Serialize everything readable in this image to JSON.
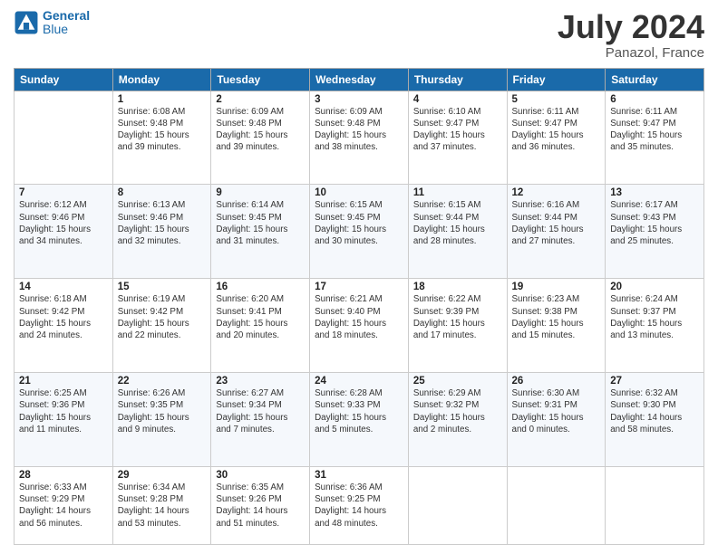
{
  "header": {
    "logo_line1": "General",
    "logo_line2": "Blue",
    "month_year": "July 2024",
    "location": "Panazol, France"
  },
  "weekdays": [
    "Sunday",
    "Monday",
    "Tuesday",
    "Wednesday",
    "Thursday",
    "Friday",
    "Saturday"
  ],
  "weeks": [
    [
      {
        "day": "",
        "info": ""
      },
      {
        "day": "1",
        "info": "Sunrise: 6:08 AM\nSunset: 9:48 PM\nDaylight: 15 hours\nand 39 minutes."
      },
      {
        "day": "2",
        "info": "Sunrise: 6:09 AM\nSunset: 9:48 PM\nDaylight: 15 hours\nand 39 minutes."
      },
      {
        "day": "3",
        "info": "Sunrise: 6:09 AM\nSunset: 9:48 PM\nDaylight: 15 hours\nand 38 minutes."
      },
      {
        "day": "4",
        "info": "Sunrise: 6:10 AM\nSunset: 9:47 PM\nDaylight: 15 hours\nand 37 minutes."
      },
      {
        "day": "5",
        "info": "Sunrise: 6:11 AM\nSunset: 9:47 PM\nDaylight: 15 hours\nand 36 minutes."
      },
      {
        "day": "6",
        "info": "Sunrise: 6:11 AM\nSunset: 9:47 PM\nDaylight: 15 hours\nand 35 minutes."
      }
    ],
    [
      {
        "day": "7",
        "info": "Sunrise: 6:12 AM\nSunset: 9:46 PM\nDaylight: 15 hours\nand 34 minutes."
      },
      {
        "day": "8",
        "info": "Sunrise: 6:13 AM\nSunset: 9:46 PM\nDaylight: 15 hours\nand 32 minutes."
      },
      {
        "day": "9",
        "info": "Sunrise: 6:14 AM\nSunset: 9:45 PM\nDaylight: 15 hours\nand 31 minutes."
      },
      {
        "day": "10",
        "info": "Sunrise: 6:15 AM\nSunset: 9:45 PM\nDaylight: 15 hours\nand 30 minutes."
      },
      {
        "day": "11",
        "info": "Sunrise: 6:15 AM\nSunset: 9:44 PM\nDaylight: 15 hours\nand 28 minutes."
      },
      {
        "day": "12",
        "info": "Sunrise: 6:16 AM\nSunset: 9:44 PM\nDaylight: 15 hours\nand 27 minutes."
      },
      {
        "day": "13",
        "info": "Sunrise: 6:17 AM\nSunset: 9:43 PM\nDaylight: 15 hours\nand 25 minutes."
      }
    ],
    [
      {
        "day": "14",
        "info": "Sunrise: 6:18 AM\nSunset: 9:42 PM\nDaylight: 15 hours\nand 24 minutes."
      },
      {
        "day": "15",
        "info": "Sunrise: 6:19 AM\nSunset: 9:42 PM\nDaylight: 15 hours\nand 22 minutes."
      },
      {
        "day": "16",
        "info": "Sunrise: 6:20 AM\nSunset: 9:41 PM\nDaylight: 15 hours\nand 20 minutes."
      },
      {
        "day": "17",
        "info": "Sunrise: 6:21 AM\nSunset: 9:40 PM\nDaylight: 15 hours\nand 18 minutes."
      },
      {
        "day": "18",
        "info": "Sunrise: 6:22 AM\nSunset: 9:39 PM\nDaylight: 15 hours\nand 17 minutes."
      },
      {
        "day": "19",
        "info": "Sunrise: 6:23 AM\nSunset: 9:38 PM\nDaylight: 15 hours\nand 15 minutes."
      },
      {
        "day": "20",
        "info": "Sunrise: 6:24 AM\nSunset: 9:37 PM\nDaylight: 15 hours\nand 13 minutes."
      }
    ],
    [
      {
        "day": "21",
        "info": "Sunrise: 6:25 AM\nSunset: 9:36 PM\nDaylight: 15 hours\nand 11 minutes."
      },
      {
        "day": "22",
        "info": "Sunrise: 6:26 AM\nSunset: 9:35 PM\nDaylight: 15 hours\nand 9 minutes."
      },
      {
        "day": "23",
        "info": "Sunrise: 6:27 AM\nSunset: 9:34 PM\nDaylight: 15 hours\nand 7 minutes."
      },
      {
        "day": "24",
        "info": "Sunrise: 6:28 AM\nSunset: 9:33 PM\nDaylight: 15 hours\nand 5 minutes."
      },
      {
        "day": "25",
        "info": "Sunrise: 6:29 AM\nSunset: 9:32 PM\nDaylight: 15 hours\nand 2 minutes."
      },
      {
        "day": "26",
        "info": "Sunrise: 6:30 AM\nSunset: 9:31 PM\nDaylight: 15 hours\nand 0 minutes."
      },
      {
        "day": "27",
        "info": "Sunrise: 6:32 AM\nSunset: 9:30 PM\nDaylight: 14 hours\nand 58 minutes."
      }
    ],
    [
      {
        "day": "28",
        "info": "Sunrise: 6:33 AM\nSunset: 9:29 PM\nDaylight: 14 hours\nand 56 minutes."
      },
      {
        "day": "29",
        "info": "Sunrise: 6:34 AM\nSunset: 9:28 PM\nDaylight: 14 hours\nand 53 minutes."
      },
      {
        "day": "30",
        "info": "Sunrise: 6:35 AM\nSunset: 9:26 PM\nDaylight: 14 hours\nand 51 minutes."
      },
      {
        "day": "31",
        "info": "Sunrise: 6:36 AM\nSunset: 9:25 PM\nDaylight: 14 hours\nand 48 minutes."
      },
      {
        "day": "",
        "info": ""
      },
      {
        "day": "",
        "info": ""
      },
      {
        "day": "",
        "info": ""
      }
    ]
  ]
}
